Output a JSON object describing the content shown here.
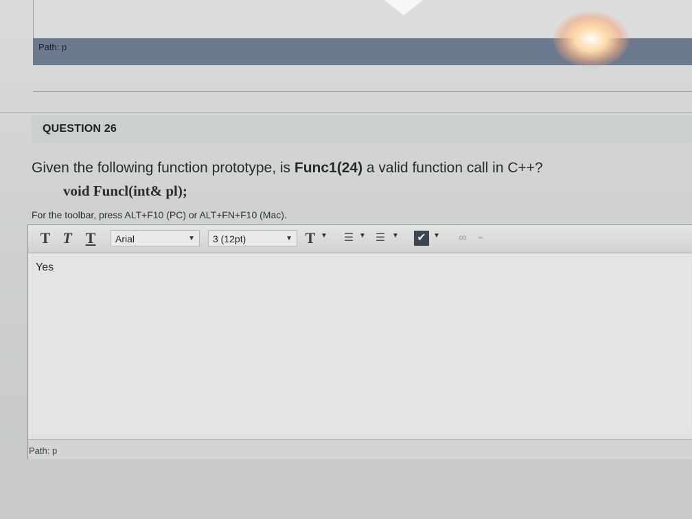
{
  "top_editor": {
    "path_label": "Path: p"
  },
  "question": {
    "number": "QUESTION 26",
    "text_before": "Given the following function prototype, is ",
    "text_bold": "Func1(24)",
    "text_after": " a valid function call in C++?",
    "prototype": "void Funcl(int& pl);",
    "toolbar_hint": "For the toolbar, press ALT+F10 (PC) or ALT+FN+F10 (Mac)."
  },
  "toolbar": {
    "bold_label": "T",
    "italic_label": "T",
    "underline_label": "T",
    "font_family": "Arial",
    "font_size": "3 (12pt)",
    "text_color_label": "T",
    "icons": [
      "bold-icon",
      "italic-icon",
      "underline-icon",
      "text-color-icon",
      "bullet-list-icon",
      "numbered-list-icon",
      "spellcheck-icon",
      "link-icon",
      "unlink-icon"
    ]
  },
  "editor": {
    "answer": "Yes",
    "path_label": "Path: p"
  }
}
